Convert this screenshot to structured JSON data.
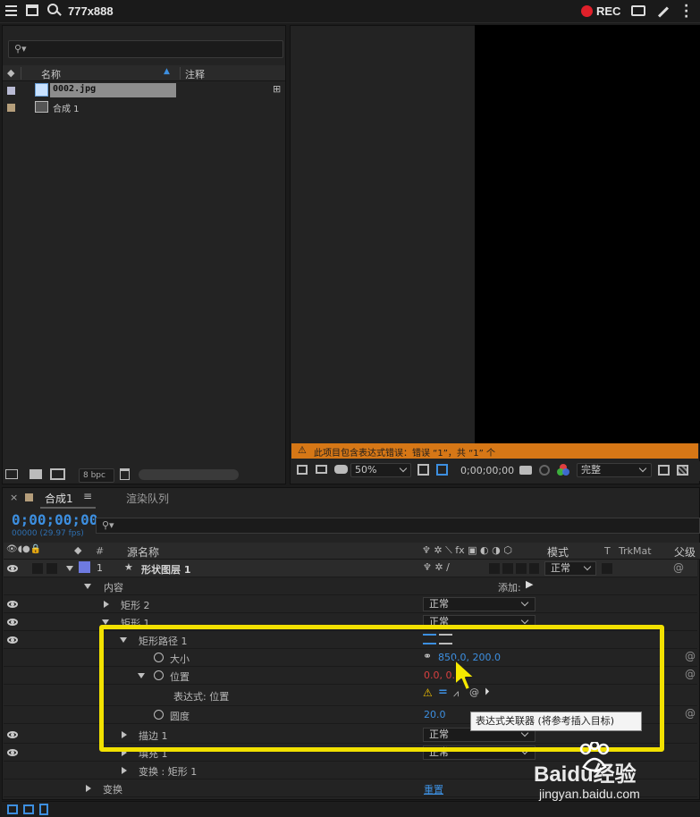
{
  "capture_bar": {
    "size_label": "777x888",
    "rec_label": "REC"
  },
  "project": {
    "columns": {
      "name": "名称",
      "comment": "注释"
    },
    "items": [
      {
        "name": "0002.jpg"
      },
      {
        "name": "合成 1"
      }
    ],
    "bpc": "8 bpc"
  },
  "viewer": {
    "warning": "此项目包含表达式错误：错误 “1”，共 “1” 个",
    "zoom": "50%",
    "timecode": "0;00;00;00",
    "quality": "完整"
  },
  "timeline": {
    "tabs": [
      {
        "label": "合成1"
      },
      {
        "label": "渲染队列"
      }
    ],
    "timecode": "0;00;00;00",
    "frame_info": "00000 (29.97 fps)",
    "headers": {
      "num": "#",
      "source_name": "源名称",
      "mode": "模式",
      "t": "T",
      "trkmat": "TrkMat",
      "parent": "父级"
    },
    "layer": {
      "num": "1",
      "name": "形状图层 1",
      "mode": "正常"
    },
    "content_label": "内容",
    "add_label": "添加:",
    "rows": {
      "rect2": "矩形 2",
      "rect1": "矩形 1",
      "rect_path": "矩形路径 1",
      "size_label": "大小",
      "size_value": "850.0, 200.0",
      "position_label": "位置",
      "position_value": "0.0, 0.0",
      "expression_label": "表达式: 位置",
      "roundness_label": "圆度",
      "roundness_value": "20.0",
      "stroke": "描边 1",
      "fill": "填充 1",
      "transform_rect": "变换 : 矩形 1",
      "transform": "变换",
      "reset": "重置",
      "blend_normal": "正常"
    },
    "tooltip": "表达式关联器 (将参考插入目标)"
  },
  "watermark": {
    "brand": "Baidu经验",
    "url": "jingyan.baidu.com"
  }
}
